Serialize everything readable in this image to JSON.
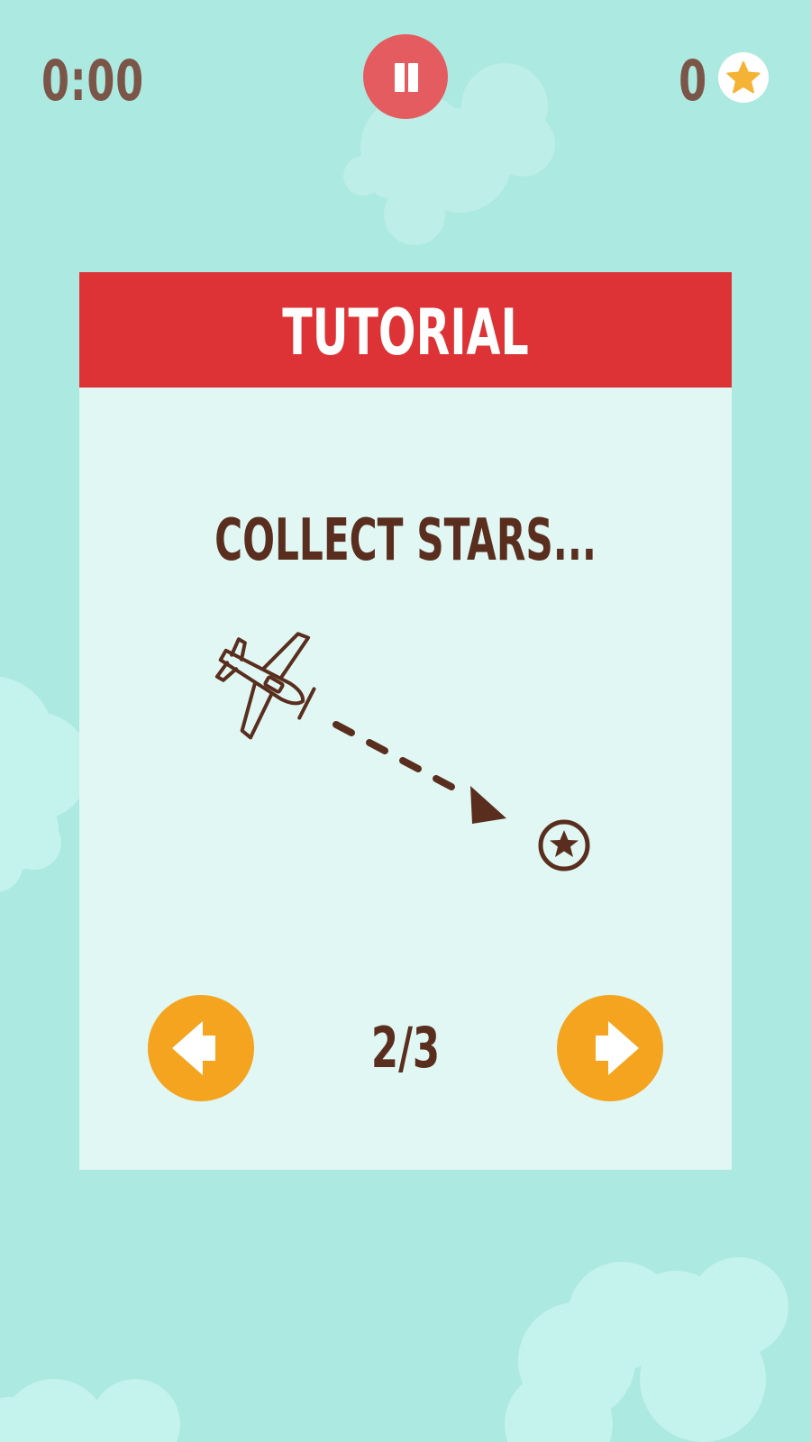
{
  "hud": {
    "timer": "0:00",
    "score": "0",
    "pause_icon": "pause-icon",
    "score_icon": "star-icon"
  },
  "tutorial": {
    "title": "TUTORIAL",
    "instruction": "COLLECT STARS...",
    "page_indicator": "2/3",
    "prev_icon": "arrow-left-icon",
    "next_icon": "arrow-right-icon",
    "illustration": {
      "icons": [
        "airplane-icon",
        "dashed-arrow-icon",
        "star-coin-icon"
      ]
    }
  },
  "colors": {
    "sky": "#ace9e1",
    "cloud": "#c4f2ec",
    "panel": "#e0f7f3",
    "header": "#dd3336",
    "pause_button": "#e45c5f",
    "nav_button": "#f4a41f",
    "text_dark": "#5a2e1e",
    "hud_text": "#7b5548",
    "star": "#f5b335"
  }
}
